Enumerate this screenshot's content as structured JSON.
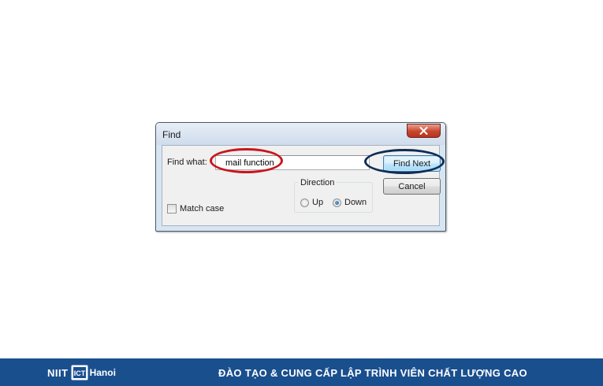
{
  "dialog": {
    "title": "Find",
    "find_label": "Find what:",
    "find_value": "mail function",
    "find_next_label": "Find Next",
    "cancel_label": "Cancel",
    "direction_legend": "Direction",
    "direction_options": [
      {
        "label": "Up",
        "checked": false
      },
      {
        "label": "Down",
        "checked": true
      }
    ],
    "match_case_label": "Match case",
    "match_case_checked": false
  },
  "annotations": {
    "highlight_input_color": "#c8161c",
    "highlight_button_color": "#0f2d57"
  },
  "footer": {
    "logo_text": "NIIT",
    "logo_mark_text": "ICT",
    "logo_city": "Hanoi",
    "tagline": "ĐÀO TẠO & CUNG CẤP LẬP TRÌNH VIÊN CHẤT LƯỢNG CAO",
    "background_color": "#1a4f8e"
  }
}
